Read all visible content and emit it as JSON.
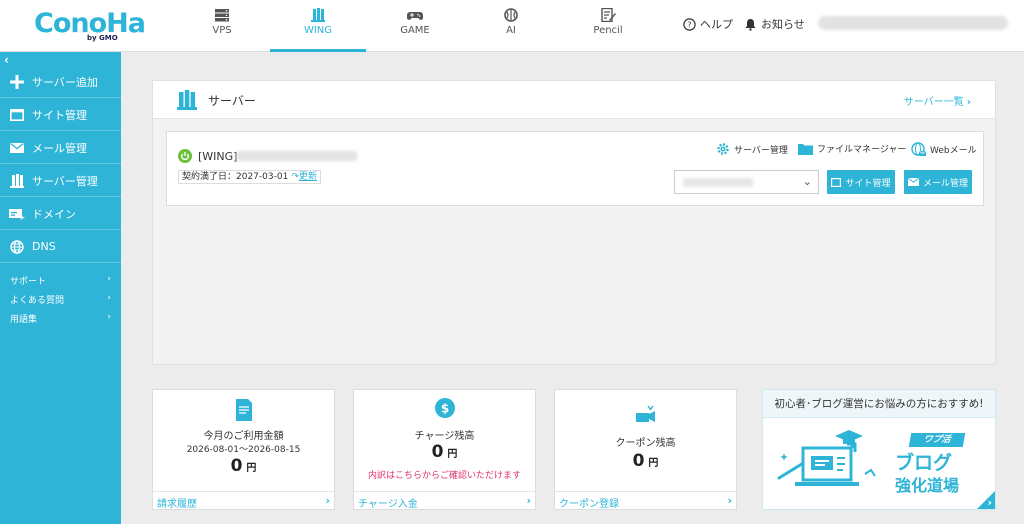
{
  "header": {
    "logo_text": "ConoHa",
    "logo_sub": "by GMO",
    "nav": [
      {
        "label": "VPS"
      },
      {
        "label": "WING"
      },
      {
        "label": "GAME"
      },
      {
        "label": "AI"
      },
      {
        "label": "Pencil"
      }
    ],
    "help_label": "ヘルプ",
    "notice_label": "お知らせ"
  },
  "sidebar": {
    "items": [
      {
        "label": "サーバー追加",
        "icon": "plus-icon"
      },
      {
        "label": "サイト管理",
        "icon": "window-icon"
      },
      {
        "label": "メール管理",
        "icon": "mail-icon"
      },
      {
        "label": "サーバー管理",
        "icon": "server-icon"
      },
      {
        "label": "ドメイン",
        "icon": "domain-icon"
      },
      {
        "label": "DNS",
        "icon": "globe-icon"
      }
    ],
    "links": [
      {
        "label": "サポート"
      },
      {
        "label": "よくある質問"
      },
      {
        "label": "用語集"
      }
    ]
  },
  "server_panel": {
    "title": "サーバー",
    "list_link": "サーバー一覧",
    "server": {
      "name": "[WING]",
      "expiry": "契約満了日：2027-03-01",
      "renew_label": "更新",
      "actions": [
        "サーバー管理",
        "ファイルマネージャー",
        "Webメール"
      ],
      "site_button": "サイト管理",
      "mail_button": "メール管理"
    }
  },
  "cards": {
    "usage": {
      "title": "今月のご利用金額",
      "period": "2026-08-01～2026-08-15",
      "amount": "0",
      "unit": "円",
      "link": "請求履歴"
    },
    "charge": {
      "title": "チャージ残高",
      "amount": "0",
      "unit": "円",
      "note": "内訳はこちらからご確認いただけます",
      "link": "チャージ入金"
    },
    "coupon": {
      "title": "クーポン残高",
      "amount": "0",
      "unit": "円",
      "link": "クーポン登録"
    }
  },
  "banner": {
    "headline": "初心者･ブログ運営にお悩みの方におすすめ!",
    "badge": "ワプ活",
    "line1": "ブログ",
    "line2": "強化道場"
  },
  "colors": {
    "accent": "#2db4d7",
    "power_green": "#6bbf3a",
    "note_red": "#e0336b"
  }
}
